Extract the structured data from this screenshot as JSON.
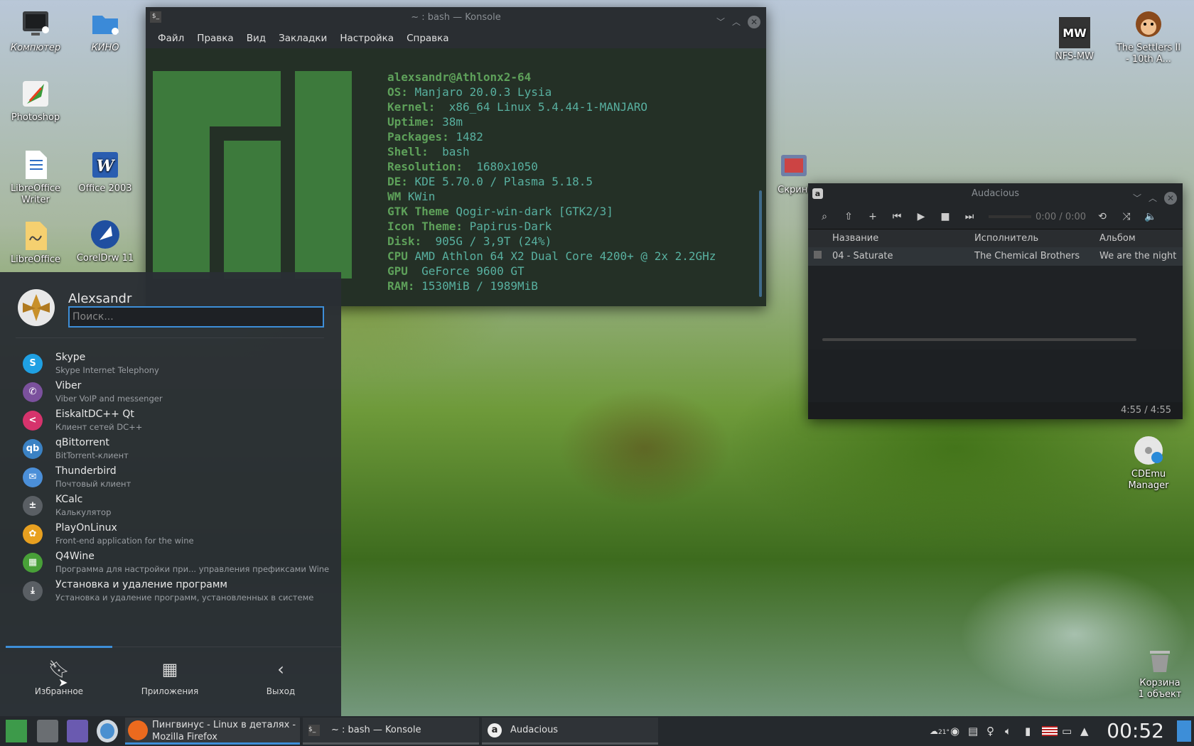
{
  "desktop": {
    "icons": [
      {
        "label": "Компютер"
      },
      {
        "label": "КИНО"
      },
      {
        "label": "Photoshop"
      },
      {
        "label": "LibreOffice Writer"
      },
      {
        "label": "Office 2003"
      },
      {
        "label": "LibreOffice"
      },
      {
        "label": "CorelDrw 11"
      },
      {
        "label": "NFS-MW"
      },
      {
        "label": "The Settlers II - 10th A..."
      },
      {
        "label": "Скрині"
      },
      {
        "label": "CDEmu Manager"
      },
      {
        "label": "Корзина",
        "sub": "1 объект"
      }
    ]
  },
  "konsole": {
    "title": "~ : bash — Konsole",
    "menu": [
      "Файл",
      "Правка",
      "Вид",
      "Закладки",
      "Настройка",
      "Справка"
    ],
    "neofetch": {
      "user": "alexsandr@Athlonx2-64",
      "rows": [
        {
          "k": "OS:",
          "v": " Manjaro 20.0.3 Lysia"
        },
        {
          "k": "Kernel:",
          "v": "  x86_64 Linux 5.4.44-1-MANJARO"
        },
        {
          "k": "Uptime:",
          "v": " 38m"
        },
        {
          "k": "Packages:",
          "v": " 1482"
        },
        {
          "k": "Shell:",
          "v": "  bash"
        },
        {
          "k": "Resolution:",
          "v": "  1680x1050"
        },
        {
          "k": "DE:",
          "v": " KDE 5.70.0 / Plasma 5.18.5"
        },
        {
          "k": "WM",
          "v": " KWin"
        },
        {
          "k": "GTK Theme",
          "v": " Qogir-win-dark [GTK2/3]"
        },
        {
          "k": "Icon Theme:",
          "v": " Papirus-Dark"
        },
        {
          "k": "Disk:",
          "v": "  905G / 3,9T (24%)"
        },
        {
          "k": "CPU",
          "v": " AMD Athlon 64 X2 Dual Core 4200+ @ 2x 2.2GHz"
        },
        {
          "k": "GPU",
          "v": "  GeForce 9600 GT"
        },
        {
          "k": "RAM:",
          "v": " 1530MiB / 1989MiB"
        }
      ]
    }
  },
  "audacious": {
    "title": "Audacious",
    "time": "0:00 / 0:00",
    "columns": [
      "Название",
      "Исполнитель",
      "Альбом"
    ],
    "rows": [
      {
        "title": "04 - Saturate",
        "artist": "The Chemical Brothers",
        "album": "We are the night"
      }
    ],
    "footer": "4:55 / 4:55"
  },
  "launcher": {
    "user": "Alexsandr",
    "search_placeholder": "Поиск...",
    "apps": [
      {
        "name": "Skype",
        "desc": "Skype Internet Telephony",
        "color": "#1fa0e3",
        "glyph": "S"
      },
      {
        "name": "Viber",
        "desc": "Viber VoIP and messenger",
        "color": "#7b519d",
        "glyph": "✆"
      },
      {
        "name": "EiskaltDC++ Qt",
        "desc": "Клиент сетей DC++",
        "color": "#d6336c",
        "glyph": "<"
      },
      {
        "name": "qBittorrent",
        "desc": "BitTorrent-клиент",
        "color": "#3b82c4",
        "glyph": "qb"
      },
      {
        "name": "Thunderbird",
        "desc": "Почтовый клиент",
        "color": "#4b8fd8",
        "glyph": "✉"
      },
      {
        "name": "KCalc",
        "desc": "Калькулятор",
        "color": "#5a5f64",
        "glyph": "±"
      },
      {
        "name": "PlayOnLinux",
        "desc": "Front-end application for the wine",
        "color": "#e8a020",
        "glyph": "✿"
      },
      {
        "name": "Q4Wine",
        "desc": "Программа для настройки при... управления префиксами Wine",
        "color": "#48a038",
        "glyph": "▦"
      },
      {
        "name": "Установка и удаление программ",
        "desc": "Установка и удаление программ, установленных в системе",
        "color": "#5a5f64",
        "glyph": "⤓"
      }
    ],
    "tabs": [
      {
        "label": "Избранное",
        "icon": "bookmark-icon"
      },
      {
        "label": "Приложения",
        "icon": "grid-icon"
      },
      {
        "label": "Выход",
        "icon": "back-icon"
      }
    ]
  },
  "taskbar": {
    "tasks": [
      {
        "label": "Пингвинус - Linux в деталях - Mozilla Firefox"
      },
      {
        "label": "~ : bash — Konsole"
      },
      {
        "label": "Audacious"
      }
    ],
    "weather": "21°",
    "clock": "00:52"
  }
}
